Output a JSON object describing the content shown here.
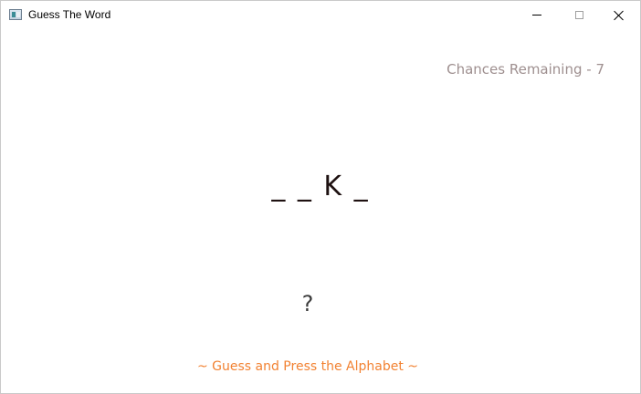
{
  "window": {
    "title": "Guess The Word"
  },
  "game": {
    "chances_text": "Chances Remaining - 7",
    "word_display": "_ _ K _",
    "current_guess": "?",
    "instruction": "~ Guess and Press the Alphabet ~"
  },
  "colors": {
    "chances": "#9e8f8f",
    "word": "#1e1111",
    "guess": "#3b3b3b",
    "instruction": "#f28232"
  },
  "icons": {
    "app": "app-window-icon",
    "minimize": "minimize-icon",
    "maximize": "maximize-icon",
    "close": "close-icon"
  }
}
